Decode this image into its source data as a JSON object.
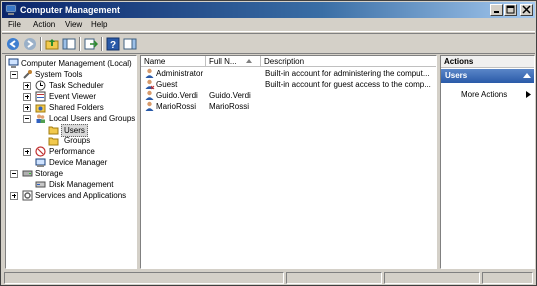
{
  "window": {
    "title": "Computer Management"
  },
  "menubar": {
    "items": [
      "File",
      "Action",
      "View",
      "Help"
    ]
  },
  "toolbar": {
    "buttons": [
      "back-icon",
      "forward-icon",
      "up-folder-icon",
      "show-hide-tree-icon",
      "export-icon",
      "help-icon",
      "show-hide-action-pane-icon"
    ]
  },
  "tree": {
    "root": "Computer Management (Local)",
    "system_tools": "System Tools",
    "task_scheduler": "Task Scheduler",
    "event_viewer": "Event Viewer",
    "shared_folders": "Shared Folders",
    "local_users_groups": "Local Users and Groups",
    "users": "Users",
    "groups": "Groups",
    "performance": "Performance",
    "device_manager": "Device Manager",
    "storage": "Storage",
    "disk_management": "Disk Management",
    "services_apps": "Services and Applications"
  },
  "list": {
    "columns": [
      "Name",
      "Full N...",
      "Description"
    ],
    "rows": [
      {
        "name": "Administrator",
        "full_name": "",
        "description": "Built-in account for administering the comput..."
      },
      {
        "name": "Guest",
        "full_name": "",
        "description": "Built-in account for guest access to the comp..."
      },
      {
        "name": "Guido.Verdi",
        "full_name": "Guido.Verdi",
        "description": ""
      },
      {
        "name": "MarioRossi",
        "full_name": "MarioRossi",
        "description": ""
      }
    ]
  },
  "actions": {
    "title": "Actions",
    "section": "Users",
    "more_actions": "More Actions"
  },
  "colors": {
    "title_bar": "#0a246a",
    "actions_header": "#2a5aa8",
    "window_bg": "#d4d0c8"
  }
}
